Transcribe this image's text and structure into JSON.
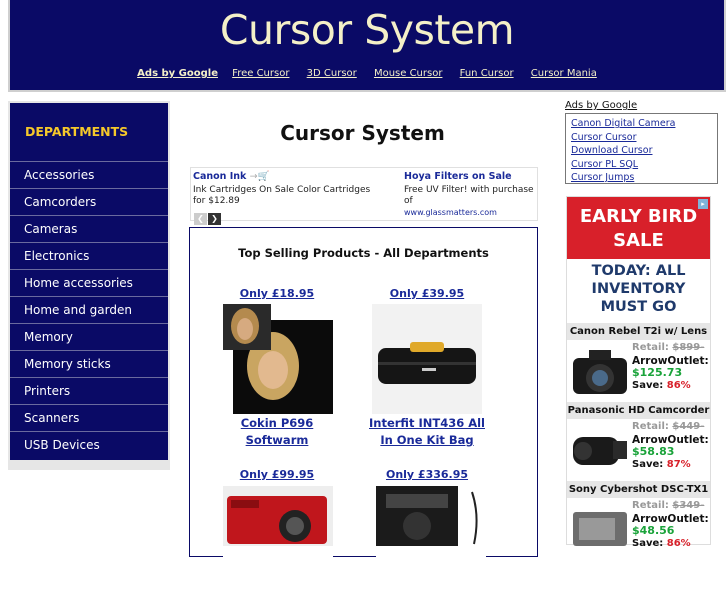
{
  "header": {
    "title": "Cursor System",
    "links": [
      {
        "label": "Ads by Google"
      },
      {
        "label": "Free Cursor"
      },
      {
        "label": "3D Cursor"
      },
      {
        "label": "Mouse Cursor"
      },
      {
        "label": "Fun Cursor"
      },
      {
        "label": "Cursor Mania"
      }
    ]
  },
  "sidebar": {
    "title": "DEPARTMENTS",
    "items": [
      {
        "label": "Accessories"
      },
      {
        "label": "Camcorders"
      },
      {
        "label": "Cameras"
      },
      {
        "label": "Electronics"
      },
      {
        "label": "Home accessories"
      },
      {
        "label": "Home and garden"
      },
      {
        "label": "Memory"
      },
      {
        "label": "Memory sticks"
      },
      {
        "label": "Printers"
      },
      {
        "label": "Scanners"
      },
      {
        "label": "USB Devices"
      }
    ]
  },
  "main": {
    "title": "Cursor System",
    "ads": [
      {
        "title": "Canon Ink",
        "body": "Ink Cartridges On Sale Color Cartridges for $12.89",
        "url": ""
      },
      {
        "title": "Hoya Filters on Sale",
        "body": "Free UV Filter! with purchase of",
        "url": "www.glassmatters.com"
      }
    ],
    "products_heading": "Top Selling Products - All Departments",
    "products": [
      {
        "price": "Only £18.95",
        "name_line1": "Cokin P696",
        "name_line2": "Softwarm"
      },
      {
        "price": "Only £39.95",
        "name_line1": "Interfit INT436 All",
        "name_line2": "In One Kit Bag"
      },
      {
        "price": "Only £99.95",
        "name_line1": "",
        "name_line2": ""
      },
      {
        "price": "Only £336.95",
        "name_line1": "",
        "name_line2": ""
      }
    ]
  },
  "right": {
    "ads_label": "Ads by Google",
    "links": [
      {
        "label": "Canon Digital Camera"
      },
      {
        "label": "Cursor Cursor"
      },
      {
        "label": "Download Cursor"
      },
      {
        "label": "Cursor PL SQL"
      },
      {
        "label": "Cursor Jumps"
      }
    ],
    "banner": {
      "headline_line1": "EARLY BIRD",
      "headline_line2": "SALE",
      "sub_line1": "TODAY: ALL",
      "sub_line2": "INVENTORY",
      "sub_line3": "MUST GO",
      "deals": [
        {
          "name": "Canon Rebel T2i w/ Lens",
          "retail_label": "Retail:",
          "retail": "$899-",
          "ao": "ArrowOutlet:",
          "price": "$125.73",
          "save_label": "Save:",
          "save": "86%"
        },
        {
          "name": "Panasonic HD Camcorder",
          "retail_label": "Retail:",
          "retail": "$449-",
          "ao": "ArrowOutlet:",
          "price": "$58.83",
          "save_label": "Save:",
          "save": "87%"
        },
        {
          "name": "Sony Cybershot DSC-TX1",
          "retail_label": "Retail:",
          "retail": "$349-",
          "ao": "ArrowOutlet:",
          "price": "$48.56",
          "save_label": "Save:",
          "save": "86%"
        }
      ]
    }
  },
  "colors": {
    "navy": "#0a0a66",
    "gold": "#f5c82a",
    "link": "#1a2a99",
    "sale_red": "#d8202a",
    "price_green": "#1aa33a"
  }
}
